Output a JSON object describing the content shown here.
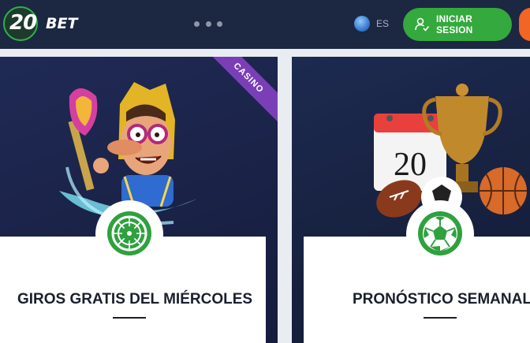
{
  "header": {
    "logo_number": "20",
    "logo_text": "BET",
    "language": "ES",
    "login_label": "INICIAR SESION"
  },
  "promos": [
    {
      "badge": "CASINO",
      "title": "GIROS GRATIS DEL MIÉRCOLES",
      "icon": "roulette-icon"
    },
    {
      "title": "PRONÓSTICO SEMANAL",
      "calendar_number": "20",
      "icon": "soccer-ball-icon"
    }
  ],
  "colors": {
    "header_bg": "#1c2742",
    "accent_green": "#34a93d",
    "casino_purple": "#7a3fb6",
    "accent_orange": "#f26522"
  }
}
